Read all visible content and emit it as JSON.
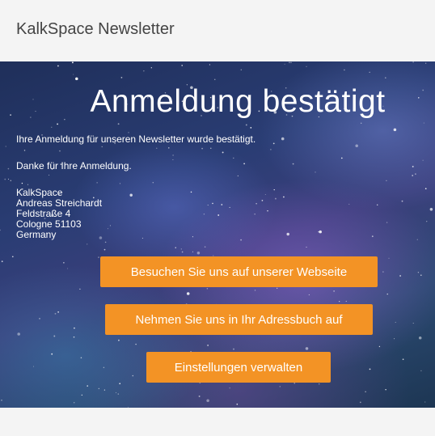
{
  "header": {
    "title": "KalkSpace Newsletter"
  },
  "hero": {
    "title": "Anmeldung bestätigt",
    "message": "Ihre Anmeldung für unseren Newsletter wurde bestätigt.",
    "thanks": "Danke für Ihre Anmeldung.",
    "address": {
      "company": "KalkSpace",
      "name": "Andreas Streichardt",
      "street": "Feldstraße 4",
      "city": "Cologne 51103",
      "country": "Germany"
    }
  },
  "buttons": {
    "website": "Besuchen Sie uns auf unserer Webseite",
    "addressbook": "Nehmen Sie uns in Ihr Adressbuch auf",
    "preferences": "Einstellungen verwalten"
  },
  "colors": {
    "button": "#f39325",
    "page_background": "#f4f4f4",
    "hero_background": "#2a3d74"
  }
}
